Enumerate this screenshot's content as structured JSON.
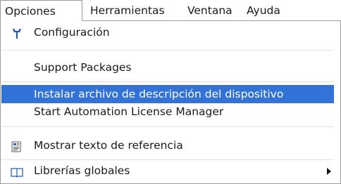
{
  "menubar": {
    "items": [
      "Opciones",
      "Herramientas",
      "Ventana",
      "Ayuda"
    ]
  },
  "menu": {
    "items": [
      {
        "label": "Configuración",
        "icon": "wrench-icon"
      },
      {
        "label": "Support Packages"
      },
      {
        "label": "Instalar archivo de descripción del dispositivo",
        "highlighted": true
      },
      {
        "label": "Start Automation License Manager"
      },
      {
        "label": "Mostrar texto de referencia",
        "icon": "reference-text-icon"
      },
      {
        "label": "Librerías globales",
        "icon": "library-book-icon",
        "has_submenu": true
      }
    ]
  },
  "colors": {
    "highlight": "#3372d6",
    "wrench": "#1f55b5"
  }
}
